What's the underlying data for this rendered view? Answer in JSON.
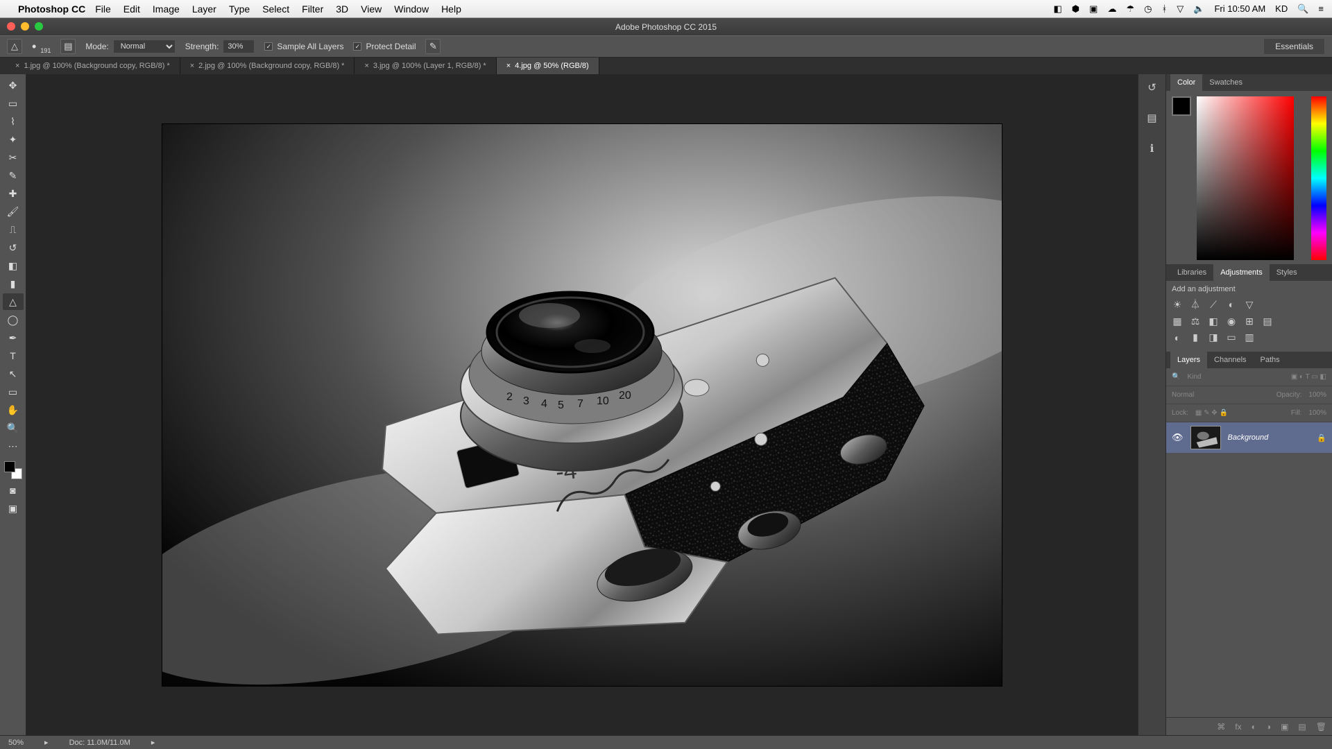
{
  "menubar": {
    "app": "Photoshop CC",
    "items": [
      "File",
      "Edit",
      "Image",
      "Layer",
      "Type",
      "Select",
      "Filter",
      "3D",
      "View",
      "Window",
      "Help"
    ],
    "clock": "Fri 10:50 AM",
    "user": "KD"
  },
  "titlebar": {
    "title": "Adobe Photoshop CC 2015"
  },
  "options": {
    "brush_size": "191",
    "mode_label": "Mode:",
    "mode_value": "Normal",
    "strength_label": "Strength:",
    "strength_value": "30%",
    "sample_label": "Sample All Layers",
    "protect_label": "Protect Detail",
    "essentials": "Essentials"
  },
  "tabs": [
    {
      "label": "1.jpg @ 100% (Background copy, RGB/8) *",
      "close": "×"
    },
    {
      "label": "2.jpg @ 100% (Background copy, RGB/8) *",
      "close": "×"
    },
    {
      "label": "3.jpg @ 100% (Layer 1, RGB/8) *",
      "close": "×"
    },
    {
      "label": "4.jpg @ 50% (RGB/8)",
      "close": "×"
    }
  ],
  "panels": {
    "color_tabs": [
      "Color",
      "Swatches"
    ],
    "lib_tabs": [
      "Libraries",
      "Adjustments",
      "Styles"
    ],
    "adj_label": "Add an adjustment",
    "layer_tabs": [
      "Layers",
      "Channels",
      "Paths"
    ],
    "filter_placeholder": "Kind",
    "blend_mode": "Normal",
    "opacity_label": "Opacity:",
    "opacity_value": "100%",
    "lock_label": "Lock:",
    "fill_label": "Fill:",
    "fill_value": "100%",
    "layer_name": "Background"
  },
  "status": {
    "zoom": "50%",
    "doc": "Doc: 11.0M/11.0M"
  }
}
